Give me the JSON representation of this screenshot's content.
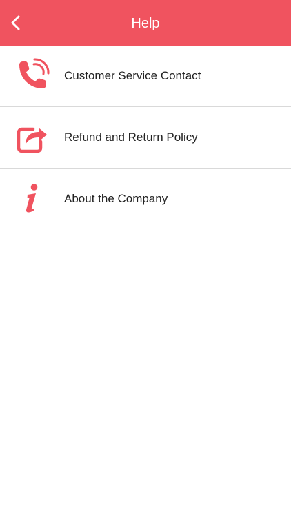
{
  "header": {
    "title": "Help",
    "back_icon": "chevron-left-icon",
    "background_color": "#f0535f"
  },
  "menu": {
    "accent_color": "#f0535f",
    "items": [
      {
        "label": "Customer Service Contact",
        "icon": "phone-ringing-icon"
      },
      {
        "label": "Refund and Return Policy",
        "icon": "share-arrow-icon"
      },
      {
        "label": "About the Company",
        "icon": "info-icon"
      }
    ]
  }
}
